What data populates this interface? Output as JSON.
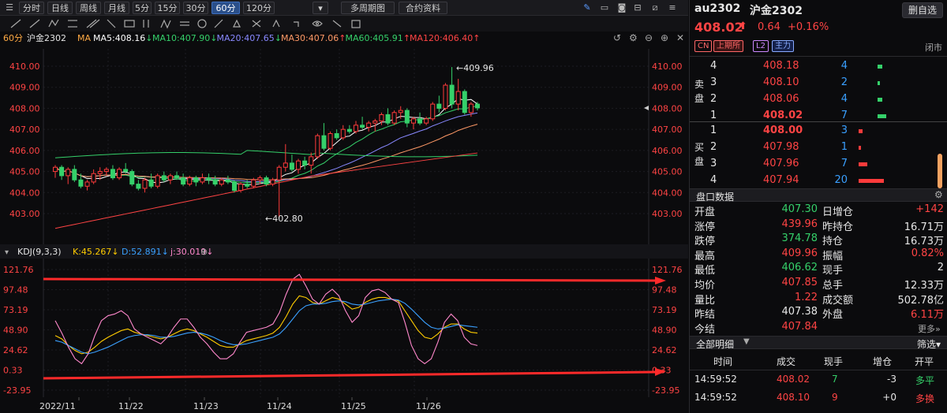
{
  "toolbar": {
    "periods": [
      "分时",
      "日线",
      "周线",
      "月线",
      "5分",
      "15分",
      "30分",
      "60分",
      "120分"
    ],
    "active_period": "60分",
    "multi_period": "多周期图",
    "contract_info": "合约资料"
  },
  "main_chart": {
    "period_label": "60分",
    "symbol_label": "沪金2302",
    "ma_prefix": "MA",
    "ma": [
      {
        "label": "MA5:408.16",
        "arrow": "↓",
        "color": "#ffffff"
      },
      {
        "label": "MA10:407.90",
        "arrow": "↓",
        "color": "#35d06a"
      },
      {
        "label": "MA20:407.65",
        "arrow": "↓",
        "color": "#8888ff"
      },
      {
        "label": "MA30:407.06",
        "arrow": "↑",
        "color": "#ff9966"
      },
      {
        "label": "MA60:405.91",
        "arrow": "↑",
        "color": "#35d06a"
      },
      {
        "label": "MA120:406.40",
        "arrow": "↑",
        "color": "#ff4444"
      }
    ],
    "y_ticks": [
      "410.00",
      "409.00",
      "408.00",
      "407.00",
      "406.00",
      "405.00",
      "404.00",
      "403.00"
    ],
    "high_annot": "409.96",
    "low_annot": "402.80"
  },
  "kdj": {
    "label": "KDJ(9,3,3)",
    "k": "K:45.267",
    "d": "D:52.891",
    "j": "j:30.019",
    "y_ticks": [
      "121.76",
      "97.48",
      "73.19",
      "48.90",
      "24.62",
      "0.33",
      "-23.95"
    ]
  },
  "x_labels": [
    "2022/11",
    "11/22",
    "11/23",
    "11/24",
    "11/25",
    "11/26"
  ],
  "chart_data": {
    "type": "candlestick",
    "price_ylim": [
      402.3,
      410.3
    ],
    "ohlc": [
      [
        405.0,
        405.3,
        404.7,
        405.2
      ],
      [
        405.2,
        405.3,
        404.6,
        404.8
      ],
      [
        404.8,
        405.2,
        404.4,
        405.1
      ],
      [
        405.1,
        405.3,
        404.5,
        404.6
      ],
      [
        404.6,
        404.9,
        404.2,
        404.3
      ],
      [
        404.3,
        404.6,
        404.1,
        404.5
      ],
      [
        404.5,
        405.1,
        404.4,
        404.9
      ],
      [
        404.9,
        405.2,
        404.6,
        405.0
      ],
      [
        405.0,
        405.2,
        404.8,
        405.1
      ],
      [
        405.1,
        405.3,
        404.6,
        404.7
      ],
      [
        404.7,
        405.2,
        404.6,
        405.1
      ],
      [
        405.1,
        405.4,
        404.9,
        405.0
      ],
      [
        405.0,
        405.1,
        404.3,
        404.4
      ],
      [
        404.4,
        404.6,
        404.1,
        404.2
      ],
      [
        404.2,
        404.7,
        404.0,
        404.6
      ],
      [
        404.6,
        404.9,
        404.2,
        404.3
      ],
      [
        404.3,
        404.9,
        404.2,
        404.8
      ],
      [
        404.8,
        405.0,
        404.5,
        404.6
      ],
      [
        404.6,
        404.9,
        404.4,
        404.8
      ],
      [
        404.8,
        405.0,
        404.6,
        404.7
      ],
      [
        404.7,
        404.9,
        404.3,
        404.4
      ],
      [
        404.4,
        404.8,
        404.3,
        404.7
      ],
      [
        404.7,
        404.8,
        404.3,
        404.5
      ],
      [
        404.5,
        404.9,
        404.4,
        404.7
      ],
      [
        404.7,
        404.9,
        404.4,
        404.6
      ],
      [
        404.6,
        404.8,
        404.3,
        404.4
      ],
      [
        404.4,
        404.7,
        404.3,
        404.6
      ],
      [
        404.6,
        404.8,
        404.4,
        404.5
      ],
      [
        404.5,
        404.6,
        404.0,
        404.1
      ],
      [
        404.1,
        404.5,
        404.0,
        404.4
      ],
      [
        404.4,
        404.6,
        404.2,
        404.3
      ],
      [
        404.3,
        404.7,
        404.2,
        404.6
      ],
      [
        404.6,
        404.8,
        404.4,
        404.7
      ],
      [
        404.7,
        404.8,
        404.3,
        404.4
      ],
      [
        404.4,
        404.7,
        404.3,
        404.6
      ],
      [
        404.6,
        405.3,
        402.8,
        405.2
      ],
      [
        405.2,
        406.3,
        405.0,
        405.4
      ],
      [
        405.4,
        405.8,
        405.0,
        405.1
      ],
      [
        405.1,
        405.6,
        404.9,
        405.5
      ],
      [
        405.5,
        405.7,
        405.1,
        405.3
      ],
      [
        405.3,
        405.9,
        404.9,
        405.7
      ],
      [
        405.7,
        406.8,
        405.6,
        406.7
      ],
      [
        406.7,
        407.3,
        406.0,
        406.1
      ],
      [
        406.1,
        406.9,
        406.0,
        406.8
      ],
      [
        406.8,
        407.0,
        406.5,
        406.6
      ],
      [
        406.6,
        407.2,
        406.5,
        407.0
      ],
      [
        407.0,
        407.2,
        406.8,
        406.9
      ],
      [
        406.9,
        407.4,
        406.8,
        407.2
      ],
      [
        407.2,
        407.6,
        407.0,
        407.1
      ],
      [
        407.1,
        407.4,
        406.9,
        407.3
      ],
      [
        407.3,
        407.5,
        406.9,
        407.4
      ],
      [
        407.4,
        407.8,
        407.2,
        407.7
      ],
      [
        407.7,
        408.0,
        407.2,
        407.3
      ],
      [
        407.3,
        407.9,
        407.2,
        407.8
      ],
      [
        407.8,
        408.1,
        407.5,
        407.9
      ],
      [
        407.9,
        408.0,
        407.1,
        407.3
      ],
      [
        407.3,
        407.6,
        407.0,
        407.5
      ],
      [
        407.5,
        407.8,
        407.2,
        407.3
      ],
      [
        407.3,
        407.6,
        407.2,
        407.5
      ],
      [
        407.5,
        408.3,
        407.4,
        408.2
      ],
      [
        408.2,
        408.6,
        407.8,
        408.0
      ],
      [
        408.0,
        409.2,
        407.9,
        409.1
      ],
      [
        409.1,
        409.96,
        408.0,
        408.2
      ],
      [
        408.2,
        409.4,
        407.9,
        408.8
      ],
      [
        408.8,
        408.9,
        407.7,
        407.8
      ],
      [
        407.8,
        408.3,
        407.6,
        408.2
      ],
      [
        408.2,
        408.3,
        407.9,
        408.02
      ]
    ],
    "kdj_ylim": [
      -23.95,
      121.76
    ],
    "K": [
      42,
      38,
      30,
      24,
      20,
      22,
      28,
      35,
      40,
      44,
      48,
      50,
      46,
      44,
      42,
      40,
      38,
      40,
      44,
      48,
      50,
      48,
      44,
      40,
      35,
      30,
      28,
      28,
      32,
      36,
      38,
      40,
      42,
      45,
      52,
      65,
      80,
      90,
      88,
      82,
      80,
      84,
      88,
      86,
      80,
      74,
      76,
      82,
      86,
      88,
      88,
      86,
      84,
      72,
      60,
      48,
      40,
      38,
      44,
      52,
      56,
      56,
      50,
      46,
      45
    ],
    "D": [
      36,
      34,
      30,
      26,
      22,
      20,
      22,
      25,
      28,
      32,
      36,
      40,
      42,
      43,
      43,
      42,
      40,
      40,
      41,
      43,
      45,
      46,
      45,
      43,
      40,
      36,
      33,
      31,
      31,
      32,
      34,
      36,
      38,
      40,
      44,
      52,
      62,
      72,
      78,
      80,
      80,
      81,
      83,
      84,
      83,
      80,
      79,
      80,
      82,
      84,
      85,
      86,
      85,
      81,
      74,
      66,
      58,
      52,
      50,
      51,
      53,
      55,
      54,
      53,
      52
    ],
    "J": [
      60,
      45,
      28,
      14,
      8,
      20,
      42,
      60,
      66,
      68,
      72,
      66,
      50,
      44,
      40,
      36,
      32,
      40,
      52,
      62,
      62,
      52,
      40,
      32,
      22,
      14,
      14,
      20,
      34,
      46,
      48,
      50,
      52,
      56,
      70,
      92,
      110,
      116,
      102,
      86,
      80,
      92,
      98,
      90,
      72,
      58,
      66,
      88,
      96,
      98,
      94,
      86,
      82,
      58,
      30,
      14,
      8,
      14,
      34,
      58,
      68,
      60,
      40,
      32,
      30
    ]
  },
  "right_panel": {
    "symbol": "au2302",
    "name": "沪金2302",
    "watch_btn": "删自选",
    "price": "408.02",
    "arrow": "⬆",
    "change": "0.64",
    "change_pct": "+0.16%",
    "badges": [
      "CN",
      "上期所",
      "L2",
      "主力"
    ],
    "status": "闭市",
    "sell_label": "卖盘",
    "buy_label": "买盘",
    "asks": [
      {
        "lvl": "4",
        "price": "408.18",
        "vol": "4",
        "bar": 0.2
      },
      {
        "lvl": "3",
        "price": "408.10",
        "vol": "2",
        "bar": 0.1
      },
      {
        "lvl": "2",
        "price": "408.06",
        "vol": "4",
        "bar": 0.2
      },
      {
        "lvl": "1",
        "price": "408.02",
        "vol": "7",
        "bar": 0.35
      }
    ],
    "bids": [
      {
        "lvl": "1",
        "price": "408.00",
        "vol": "3",
        "bar": 0.15
      },
      {
        "lvl": "2",
        "price": "407.98",
        "vol": "1",
        "bar": 0.05
      },
      {
        "lvl": "3",
        "price": "407.96",
        "vol": "7",
        "bar": 0.35
      },
      {
        "lvl": "4",
        "price": "407.94",
        "vol": "20",
        "bar": 1.0
      }
    ],
    "quote_title": "盘口数据",
    "quote_rows": [
      {
        "l": "开盘",
        "lv": "407.30",
        "lc": "grn",
        "r": "日增仓",
        "rv": "+142",
        "rc": "red"
      },
      {
        "l": "涨停",
        "lv": "439.96",
        "lc": "red",
        "r": "昨持仓",
        "rv": "16.71万",
        "rc": "wht"
      },
      {
        "l": "跌停",
        "lv": "374.78",
        "lc": "grn",
        "r": "持仓",
        "rv": "16.73万",
        "rc": "wht"
      },
      {
        "l": "最高",
        "lv": "409.96",
        "lc": "red",
        "r": "振幅",
        "rv": "0.82%",
        "rc": "red"
      },
      {
        "l": "最低",
        "lv": "406.62",
        "lc": "grn",
        "r": "现手",
        "rv": "2",
        "rc": "wht"
      },
      {
        "l": "均价",
        "lv": "407.85",
        "lc": "red",
        "r": "总手",
        "rv": "12.33万",
        "rc": "wht"
      },
      {
        "l": "量比",
        "lv": "1.22",
        "lc": "red",
        "r": "成交额",
        "rv": "502.78亿",
        "rc": "wht"
      },
      {
        "l": "昨结",
        "lv": "407.38",
        "lc": "wht",
        "r": "外盘",
        "rv": "6.11万",
        "rc": "red"
      },
      {
        "l": "今结",
        "lv": "407.84",
        "lc": "red",
        "r": "",
        "rv": "",
        "rc": "wht"
      }
    ],
    "more": "更多»",
    "detail_title": "全部明细",
    "filter": "筛选",
    "detail_headers": [
      "时间",
      "成交",
      "现手",
      "增仓",
      "开平"
    ],
    "details": [
      {
        "t": "14:59:52",
        "p": "408.02",
        "v": "7",
        "d": "-3",
        "o": "多平"
      },
      {
        "t": "14:59:52",
        "p": "408.10",
        "v": "9",
        "d": "+0",
        "o": "多换"
      }
    ]
  }
}
